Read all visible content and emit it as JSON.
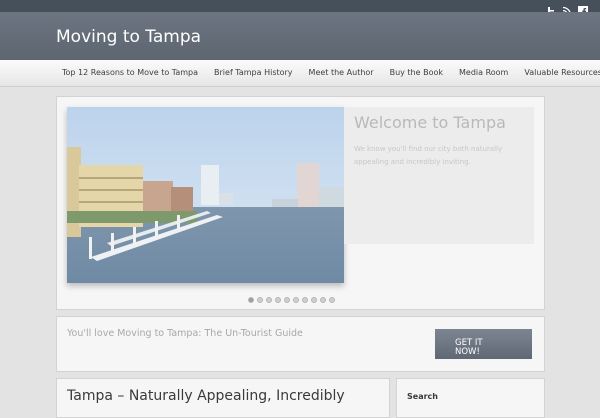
{
  "colors": {
    "topbar": "#46505a",
    "header": "#626b76",
    "page_background": "#e3e3e3",
    "button": "#6a737e"
  },
  "social_icons": [
    "twitter-icon",
    "rss-icon",
    "facebook-icon"
  ],
  "site": {
    "title": "Moving to Tampa"
  },
  "nav": {
    "items": [
      "Top 12 Reasons to Move to Tampa",
      "Brief Tampa History",
      "Meet the Author",
      "Buy the Book",
      "Media Room",
      "Valuable Resources"
    ]
  },
  "slider": {
    "title": "Welcome to Tampa",
    "text": "We know you'll find our city both naturally appealing and incredibly inviting.",
    "slide_count": 10,
    "active_slide": 1
  },
  "cta": {
    "text": "You'll love Moving to Tampa: The Un-Tourist Guide",
    "button_line1": "GET IT",
    "button_line2": "NOW!"
  },
  "post": {
    "title": "Tampa – Naturally Appealing, Incredibly"
  },
  "sidebar": {
    "search_label": "Search"
  }
}
